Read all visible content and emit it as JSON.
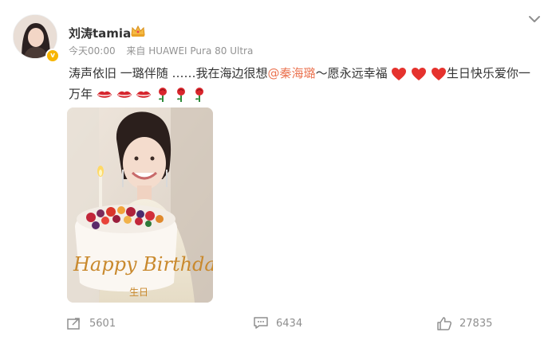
{
  "post": {
    "username": "刘涛tamia",
    "time": "今天00:00",
    "source": "来自 HUAWEI Pura 80 Ultra",
    "text_part1": "涛声依旧 一璐伴随 ……我在海边很想",
    "mention": "@秦海璐",
    "text_part2": "～愿永远幸福",
    "text_part3": "生日快乐爱你一",
    "text_part4": "万年",
    "image": {
      "cake_text": "Happy Birthday",
      "small_text": "生日"
    }
  },
  "actions": {
    "repost_count": "5601",
    "comment_count": "6434",
    "like_count": "27835"
  },
  "colors": {
    "mention": "#eb7350",
    "meta": "#939393",
    "badge": "#f7b500"
  }
}
